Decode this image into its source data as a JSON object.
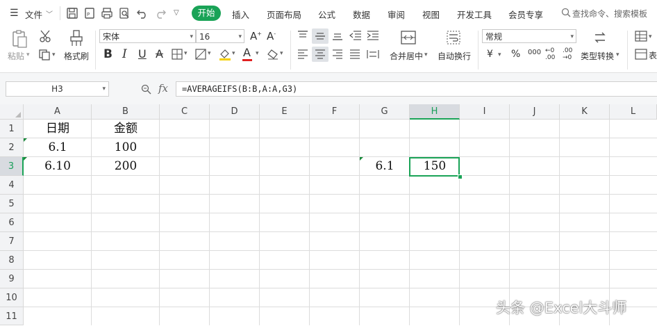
{
  "menu": {
    "file": "文件",
    "tabs": [
      "开始",
      "插入",
      "页面布局",
      "公式",
      "数据",
      "审阅",
      "视图",
      "开发工具",
      "会员专享"
    ],
    "search_placeholder": "查找命令、搜索模板"
  },
  "ribbon": {
    "paste": "粘贴",
    "format_painter": "格式刷",
    "font_name": "宋体",
    "font_size": "16",
    "merge_center": "合并居中",
    "wrap_text": "自动换行",
    "number_format": "常规",
    "type_convert": "类型转换",
    "table_style": "表",
    "currency": "¥",
    "percent": "%",
    "thousands": "000"
  },
  "formula_bar": {
    "name_box": "H3",
    "fx": "fx",
    "formula": "=AVERAGEIFS(B:B,A:A,G3)"
  },
  "sheet": {
    "columns": [
      "A",
      "B",
      "C",
      "D",
      "E",
      "F",
      "G",
      "H",
      "I",
      "J",
      "K",
      "L"
    ],
    "rows": [
      "1",
      "2",
      "3",
      "4",
      "5",
      "6",
      "7",
      "8",
      "9",
      "10",
      "11"
    ],
    "cells": {
      "A1": "日期",
      "B1": "金额",
      "A2": "6.1",
      "B2": "100",
      "A3": "6.10",
      "B3": "200",
      "G3": "6.1",
      "H3": "150"
    },
    "selected_column": "H",
    "selected_row": "3"
  },
  "watermark": "头条 @Excel大斗师",
  "colors": {
    "accent": "#1aa357"
  }
}
